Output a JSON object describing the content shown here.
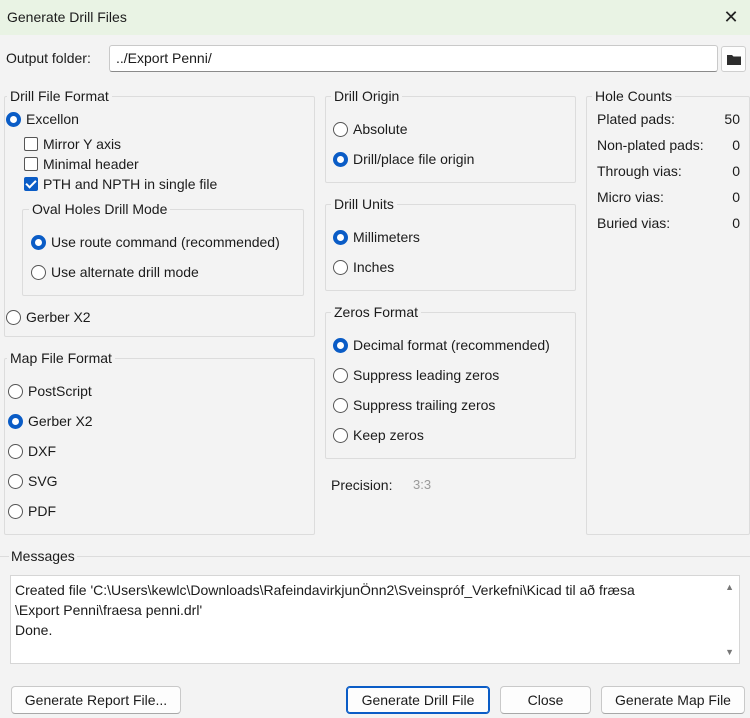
{
  "window": {
    "title": "Generate Drill Files",
    "close_glyph": "✕"
  },
  "output": {
    "label": "Output folder:",
    "value": "../Export Penni/"
  },
  "drill_format": {
    "title": "Drill File Format",
    "excellon": "Excellon",
    "mirror_y": "Mirror Y axis",
    "minimal_header": "Minimal header",
    "pth_npth": "PTH and NPTH in single file",
    "oval_title": "Oval Holes Drill Mode",
    "route": "Use route command (recommended)",
    "alternate": "Use alternate drill mode",
    "gerber": "Gerber X2",
    "mirror_checked": false,
    "minimal_checked": false,
    "pth_checked": true
  },
  "map_format": {
    "title": "Map File Format",
    "options": [
      "PostScript",
      "Gerber X2",
      "DXF",
      "SVG",
      "PDF"
    ],
    "selected": "Gerber X2"
  },
  "drill_origin": {
    "title": "Drill Origin",
    "absolute": "Absolute",
    "file_origin": "Drill/place file origin",
    "selected": "Drill/place file origin"
  },
  "drill_units": {
    "title": "Drill Units",
    "mm": "Millimeters",
    "inches": "Inches",
    "selected": "Millimeters"
  },
  "zeros": {
    "title": "Zeros Format",
    "decimal": "Decimal format (recommended)",
    "leading": "Suppress leading zeros",
    "trailing": "Suppress trailing zeros",
    "keep": "Keep zeros",
    "selected": "Decimal format (recommended)"
  },
  "precision": {
    "label": "Precision:",
    "value": "3:3"
  },
  "hole_counts": {
    "title": "Hole Counts",
    "rows": [
      {
        "label": "Plated pads:",
        "value": "50"
      },
      {
        "label": "Non-plated pads:",
        "value": "0"
      },
      {
        "label": "Through vias:",
        "value": "0"
      },
      {
        "label": "Micro vias:",
        "value": "0"
      },
      {
        "label": "Buried vias:",
        "value": "0"
      }
    ]
  },
  "messages": {
    "title": "Messages",
    "line1": "Created file 'C:\\Users\\kewlc\\Downloads\\RafeindavirkjunÖnn2\\Sveinspróf_Verkefni\\Kicad til að fræsa",
    "line2": "\\Export Penni\\fraesa penni.drl'",
    "line3": "Done."
  },
  "buttons": {
    "report": "Generate Report File...",
    "drill": "Generate Drill File",
    "close": "Close",
    "map": "Generate Map File"
  },
  "icons": {
    "folder": "folder-icon",
    "close": "close-icon"
  },
  "colors": {
    "accent": "#0a5cc6",
    "titlebar": "#e9f3e4"
  }
}
